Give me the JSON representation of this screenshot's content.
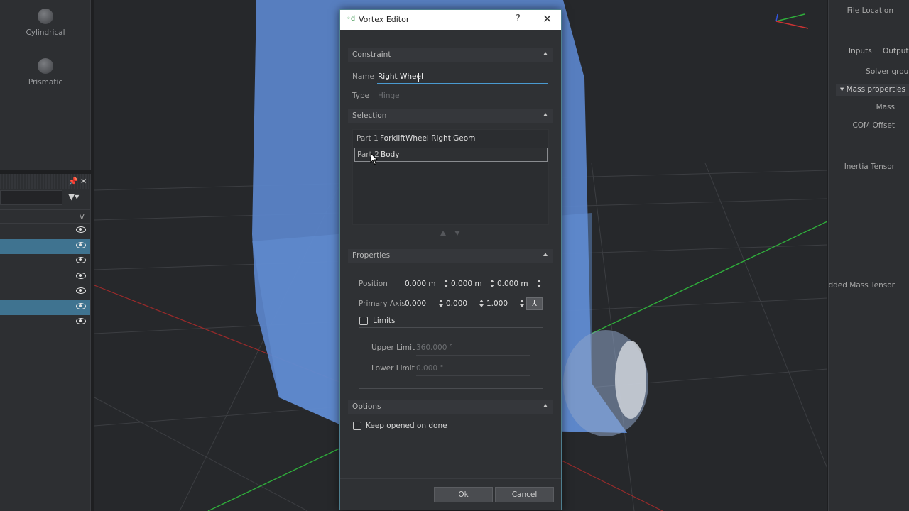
{
  "left_tools": [
    {
      "label": "Cylindrical",
      "icon": "cylindrical-joint-icon"
    },
    {
      "label": "Prismatic",
      "icon": "prismatic-joint-icon"
    }
  ],
  "explorer": {
    "column_header": "V",
    "rows": [
      {
        "selected": false
      },
      {
        "selected": true
      },
      {
        "selected": false
      },
      {
        "selected": false
      },
      {
        "selected": false
      },
      {
        "selected": true
      },
      {
        "selected": false
      }
    ]
  },
  "dialog": {
    "title": "Vortex Editor",
    "help": "?",
    "close": "✕",
    "constraint": {
      "header": "Constraint",
      "name_label": "Name",
      "name_value": "Right Wheel",
      "type_label": "Type",
      "type_value": "Hinge"
    },
    "selection": {
      "header": "Selection",
      "parts": [
        {
          "label": "Part 1",
          "value": "ForkliftWheel Right Geom",
          "selected": false
        },
        {
          "label": "Part 2",
          "value": "Body",
          "selected": true
        }
      ]
    },
    "properties": {
      "header": "Properties",
      "position_label": "Position",
      "position": [
        "0.000 m",
        "0.000 m",
        "0.000 m"
      ],
      "primary_axis_label": "Primary Axis",
      "primary_axis": [
        "0.000",
        "0.000",
        "1.000"
      ],
      "limits_label": "Limits",
      "limits_checked": false,
      "upper_limit_label": "Upper Limit",
      "upper_limit_value": "360.000 °",
      "lower_limit_label": "Lower Limit",
      "lower_limit_value": "0.000 °"
    },
    "options": {
      "header": "Options",
      "keep_opened_label": "Keep opened on done",
      "keep_opened_checked": false
    },
    "ok_label": "Ok",
    "cancel_label": "Cancel"
  },
  "right_panel": {
    "file_location": "File Location",
    "tabs": [
      "Inputs",
      "Outputs"
    ],
    "solver_group": "Solver group",
    "mass_properties": "Mass properties",
    "mass": "Mass",
    "com_offset": "COM Offset",
    "inertia_tensor": "Inertia Tensor",
    "added_mass_tensor": "Added Mass Tensor"
  },
  "colors": {
    "selection": "#3f7390",
    "accent_border": "#4e7e8e",
    "model_blue": "#5b86cc"
  }
}
